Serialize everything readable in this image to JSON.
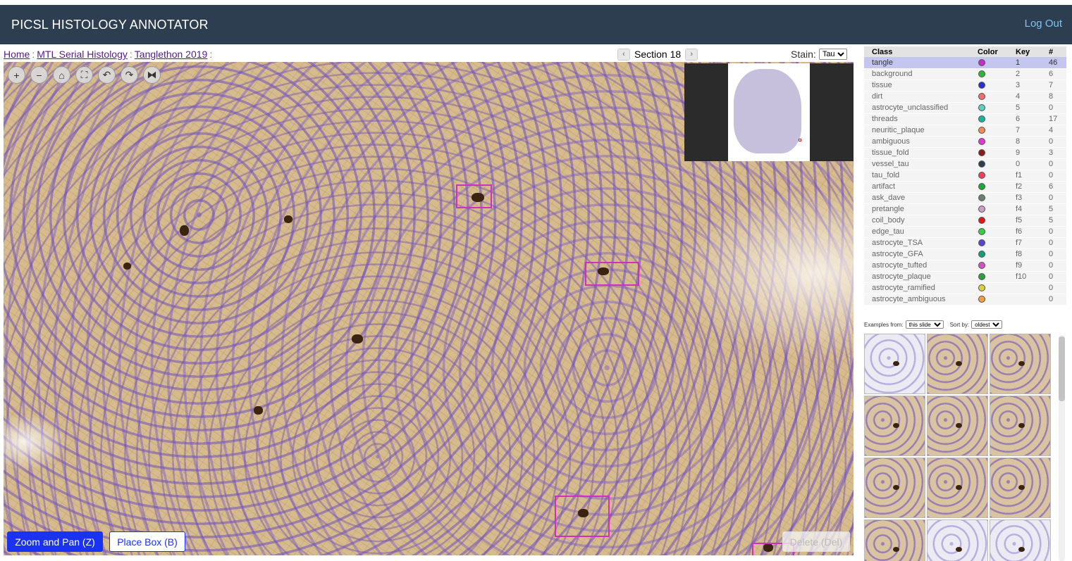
{
  "header": {
    "title": "PICSL HISTOLOGY ANNOTATOR",
    "logout": "Log Out"
  },
  "breadcrumb": {
    "home": "Home",
    "project": "MTL Serial Histology",
    "task": "Tanglethon 2019",
    "sep": ":"
  },
  "section": {
    "label": "Section 18",
    "prev": "‹",
    "next": "›"
  },
  "stain": {
    "label": "Stain:",
    "value": "Tau"
  },
  "tools": [
    {
      "name": "zoom-in-icon",
      "glyph": "+"
    },
    {
      "name": "zoom-out-icon",
      "glyph": "−"
    },
    {
      "name": "home-icon",
      "glyph": "⌂"
    },
    {
      "name": "fullscreen-icon",
      "glyph": "⛶"
    },
    {
      "name": "rotate-left-icon",
      "glyph": "↶"
    },
    {
      "name": "rotate-right-icon",
      "glyph": "↷"
    },
    {
      "name": "flip-icon",
      "glyph": "⧓"
    }
  ],
  "buttons": {
    "zoom_pan": "Zoom and Pan (Z)",
    "place_box": "Place Box (B)",
    "delete": "Delete (Del)"
  },
  "class_table": {
    "headers": [
      "Class",
      "Color",
      "Key",
      "#"
    ],
    "rows": [
      {
        "name": "tangle",
        "color": "#c62ec4",
        "key": "1",
        "count": "46",
        "selected": true
      },
      {
        "name": "background",
        "color": "#2fb53a",
        "key": "2",
        "count": "6"
      },
      {
        "name": "tissue",
        "color": "#2a2fd0",
        "key": "3",
        "count": "7"
      },
      {
        "name": "dirt",
        "color": "#f06e6e",
        "key": "4",
        "count": "8"
      },
      {
        "name": "astrocyte_unclassified",
        "color": "#58d2c2",
        "key": "5",
        "count": "0"
      },
      {
        "name": "threads",
        "color": "#18b49c",
        "key": "6",
        "count": "17"
      },
      {
        "name": "neuritic_plaque",
        "color": "#f08a5a",
        "key": "7",
        "count": "4"
      },
      {
        "name": "ambiguous",
        "color": "#e238d2",
        "key": "8",
        "count": "0"
      },
      {
        "name": "tissue_fold",
        "color": "#8c1c1c",
        "key": "9",
        "count": "3"
      },
      {
        "name": "vessel_tau",
        "color": "#2d3e50",
        "key": "0",
        "count": "0"
      },
      {
        "name": "tau_fold",
        "color": "#f0405a",
        "key": "f1",
        "count": "0"
      },
      {
        "name": "artifact",
        "color": "#1aa83a",
        "key": "f2",
        "count": "6"
      },
      {
        "name": "ask_dave",
        "color": "#6a8070",
        "key": "f3",
        "count": "0"
      },
      {
        "name": "pretangle",
        "color": "#c8a0c8",
        "key": "f4",
        "count": "5"
      },
      {
        "name": "coil_body",
        "color": "#e01818",
        "key": "f5",
        "count": "5"
      },
      {
        "name": "edge_tau",
        "color": "#30d040",
        "key": "f6",
        "count": "0"
      },
      {
        "name": "astrocyte_TSA",
        "color": "#5a44d8",
        "key": "f7",
        "count": "0"
      },
      {
        "name": "astrocyte_GFA",
        "color": "#12a07a",
        "key": "f8",
        "count": "0"
      },
      {
        "name": "astrocyte_tufted",
        "color": "#d84ec8",
        "key": "f9",
        "count": "0"
      },
      {
        "name": "astrocyte_plaque",
        "color": "#2aa040",
        "key": "f10",
        "count": "0"
      },
      {
        "name": "astrocyte_ramified",
        "color": "#d8d040",
        "key": "",
        "count": "0"
      },
      {
        "name": "astrocyte_ambiguous",
        "color": "#f0a040",
        "key": "",
        "count": "0"
      }
    ]
  },
  "examples": {
    "from_label": "Examples from:",
    "from_value": "this slide",
    "sort_label": "Sort by:",
    "sort_value": "oldest"
  },
  "thumbnails": [
    "light",
    "stained",
    "stained",
    "stained",
    "stained",
    "stained",
    "stained",
    "stained",
    "stained",
    "stained",
    "light",
    "light"
  ]
}
